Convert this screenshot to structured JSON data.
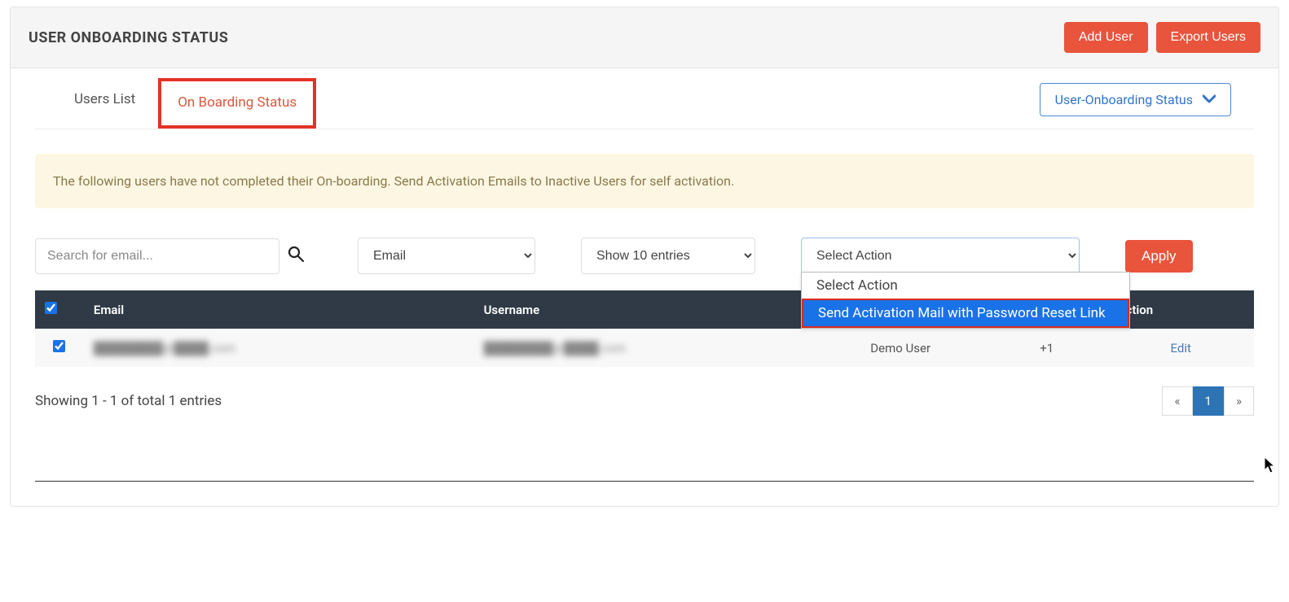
{
  "header": {
    "title": "USER ONBOARDING STATUS",
    "add_user": "Add User",
    "export_users": "Export Users"
  },
  "tabs": {
    "users_list": "Users List",
    "onboarding_status": "On Boarding Status"
  },
  "status_dropdown": {
    "label": "User-Onboarding Status"
  },
  "banner": {
    "text": "The following users have not completed their On-boarding. Send Activation Emails to Inactive Users for self activation."
  },
  "search": {
    "placeholder": "Search for email..."
  },
  "filter_select": {
    "value": "Email"
  },
  "entries_select": {
    "value": "Show 10 entries"
  },
  "action_select": {
    "value": "Select Action",
    "options": [
      "Select Action",
      "Send Activation Mail with Password Reset Link"
    ]
  },
  "apply_button": "Apply",
  "table": {
    "headers": {
      "email": "Email",
      "username": "Username",
      "fullname": "",
      "phone": "",
      "action": "Action"
    },
    "rows": [
      {
        "checked": true,
        "email": "████████@████.com",
        "username": "████████@████.com",
        "fullname": "Demo User",
        "phone": "+1",
        "action": "Edit"
      }
    ]
  },
  "footer": {
    "showing": "Showing 1 - 1 of total 1 entries",
    "pages": [
      "«",
      "1",
      "»"
    ],
    "active_page": "1"
  }
}
